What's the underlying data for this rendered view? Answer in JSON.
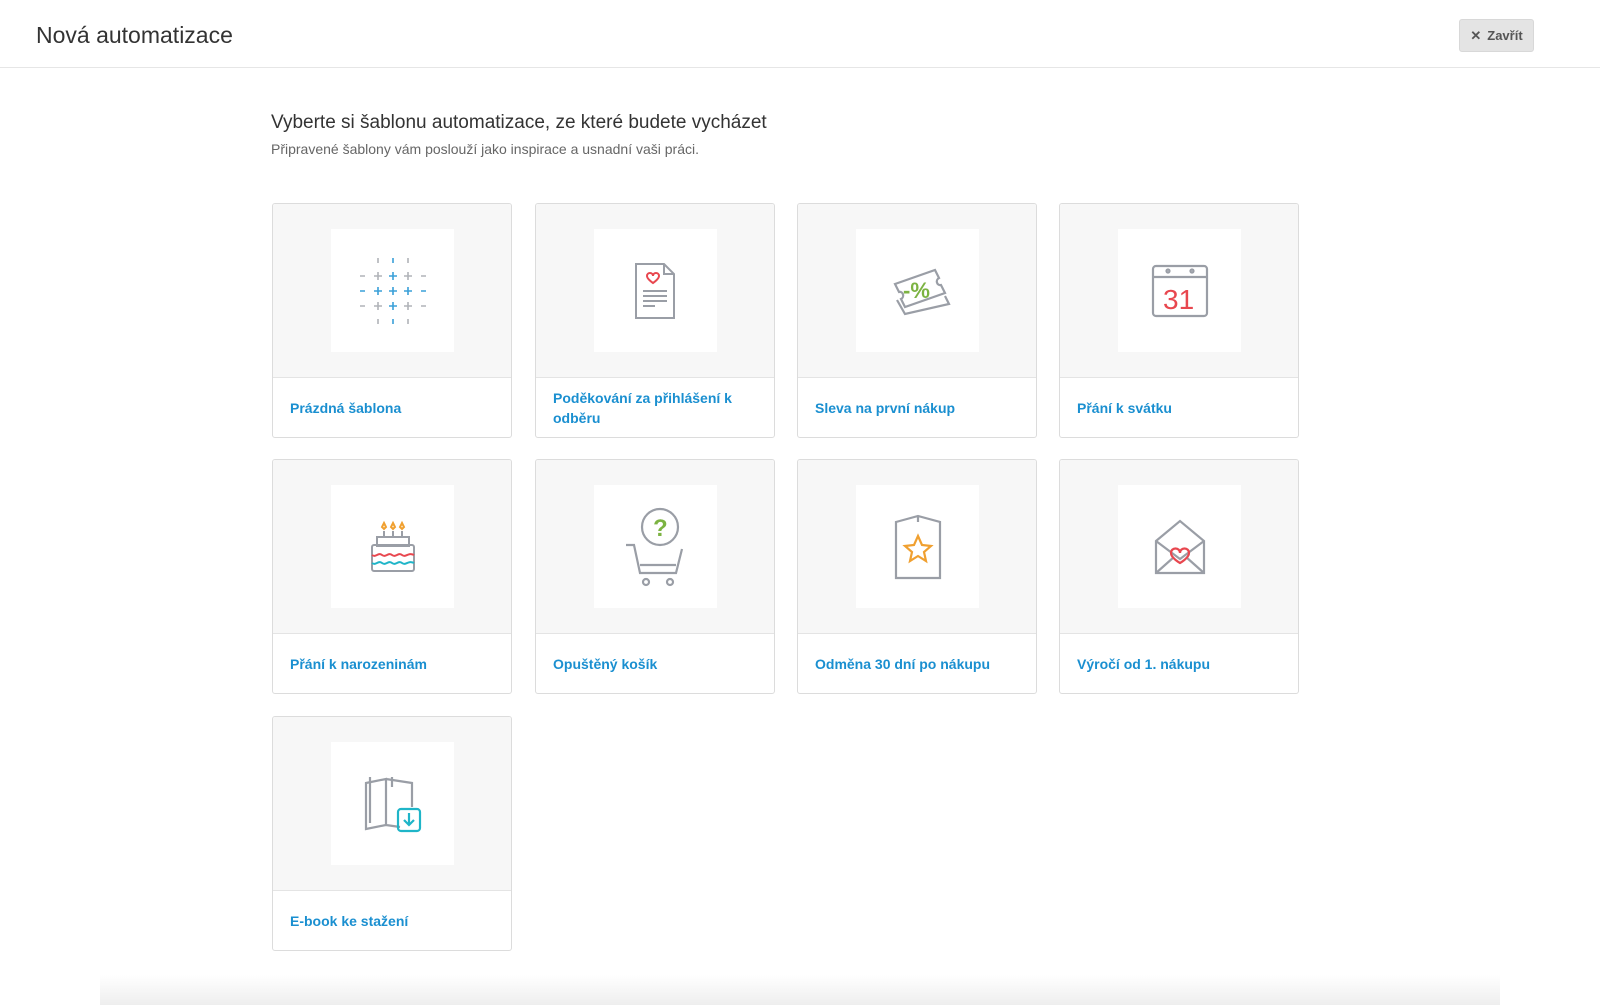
{
  "header": {
    "title": "Nová automatizace",
    "close_label": "Zavřít"
  },
  "intro": {
    "heading": "Vyberte si šablonu automatizace, ze které budete vycházet",
    "subheading": "Připravené šablony vám poslouží jako inspirace a usnadní vaši práci."
  },
  "templates": [
    {
      "label": "Prázdná šablona",
      "icon": "grid-plus-icon"
    },
    {
      "label": "Poděkování za přihlášení k odběru",
      "icon": "document-heart-icon"
    },
    {
      "label": "Sleva na první nákup",
      "icon": "discount-ticket-icon"
    },
    {
      "label": "Přání k svátku",
      "icon": "calendar-icon",
      "icon_text": "31"
    },
    {
      "label": "Přání k narozeninám",
      "icon": "birthday-cake-icon"
    },
    {
      "label": "Opuštěný košík",
      "icon": "cart-question-icon",
      "icon_text": "?"
    },
    {
      "label": "Odměna 30 dní po nákupu",
      "icon": "star-card-icon"
    },
    {
      "label": "Výročí od 1. nákupu",
      "icon": "envelope-heart-icon"
    },
    {
      "label": "E-book ke stažení",
      "icon": "ebook-download-icon"
    }
  ],
  "colors": {
    "link": "#1a8fd0",
    "icon_gray": "#9a9ea6",
    "red": "#e8474f",
    "green": "#7cb342",
    "orange": "#f0a030",
    "teal": "#1fb5c8"
  }
}
